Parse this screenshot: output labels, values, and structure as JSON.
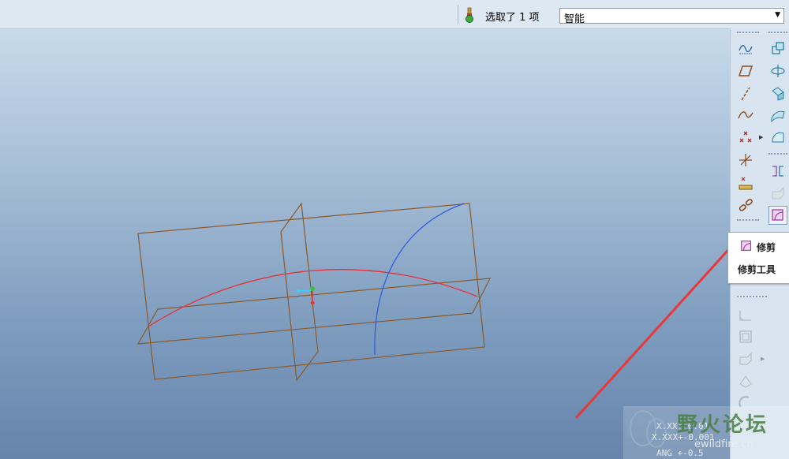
{
  "topbar": {
    "selection_status": "选取了 1 项",
    "filter_dropdown": {
      "selected": "智能"
    }
  },
  "tooltip": {
    "title": "修剪",
    "subtitle": "修剪工具"
  },
  "watermark": {
    "brand": "野火论坛",
    "url": "ewildfire.cn",
    "tolerance_lines": [
      "X.XX+-0.01",
      "X.XXX+-0.001",
      "ANG +-0.5"
    ]
  },
  "colors": {
    "datum_plane": "#8b5a2b",
    "red_curve": "#e8303c",
    "blue_curve": "#2f5fe0",
    "annotation_arrow": "#e8383a"
  },
  "icons": {
    "left_column": [
      "sketch-icon",
      "plane-icon",
      "axis-icon",
      "curve-icon",
      "point-icon",
      "csys-icon",
      "analysis-icon",
      "chain-icon"
    ],
    "right_column": [
      "copy-icon",
      "mirror-move-icon",
      "extrude-icon",
      "surface-icon",
      "boundary-icon",
      "mirror-icon",
      "merge-icon",
      "trim-icon"
    ]
  }
}
